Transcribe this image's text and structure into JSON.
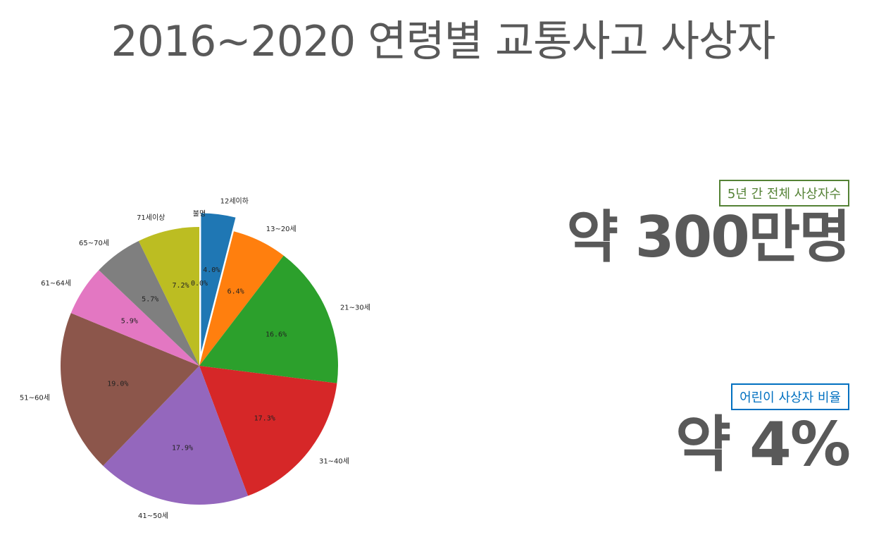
{
  "title": "2016~2020 연령별 교통사고 사상자",
  "stats": {
    "total": {
      "label": "5년 간 전체 사상자수",
      "value": "약 300만명",
      "color": "#548235"
    },
    "child": {
      "label": "어린이 사상자 비율",
      "value": "약 4%",
      "color": "#0070C0"
    }
  },
  "chart_data": {
    "type": "pie",
    "start_angle_deg": 90,
    "direction": "clockwise",
    "explode": "12세이하",
    "categories": [
      "12세이하",
      "13~20세",
      "21~30세",
      "31~40세",
      "41~50세",
      "51~60세",
      "61~64세",
      "65~70세",
      "71세이상",
      "불명"
    ],
    "values": [
      4.0,
      6.4,
      16.6,
      17.3,
      17.9,
      19.0,
      5.9,
      5.7,
      7.2,
      0.0
    ],
    "value_labels": [
      "4.0%",
      "6.4%",
      "16.6%",
      "17.3%",
      "17.9%",
      "19.0%",
      "5.9%",
      "5.7%",
      "7.2%",
      "0.0%"
    ],
    "colors": [
      "#1f77b4",
      "#ff7f0e",
      "#2ca02c",
      "#d62728",
      "#9467bd",
      "#8c564b",
      "#e377c2",
      "#7f7f7f",
      "#bcbd22",
      "#17becf"
    ]
  }
}
